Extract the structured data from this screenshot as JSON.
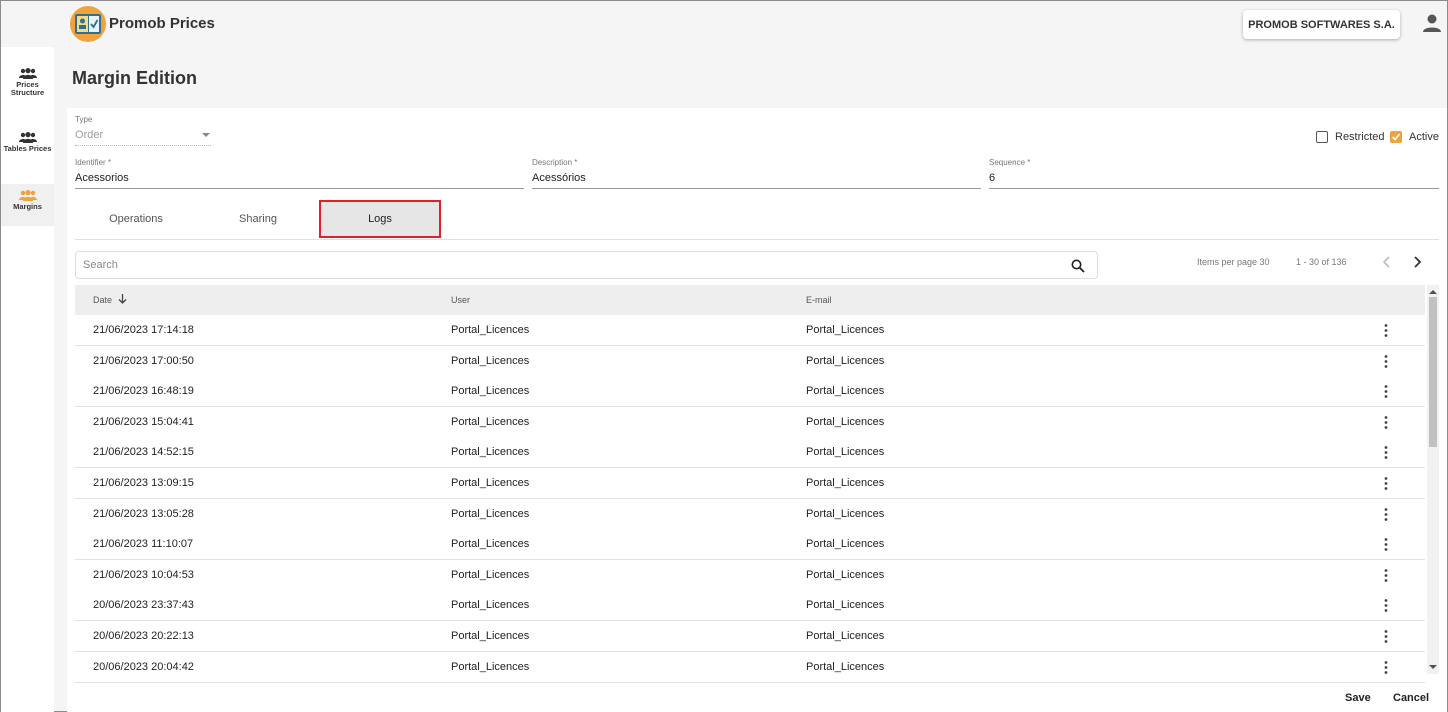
{
  "app": {
    "title": "Promob Prices",
    "company": "PROMOB SOFTWARES S.A.",
    "logo_icon": "price-tag-logo-icon",
    "accent_color": "#f0a23c"
  },
  "sidebar": {
    "items": [
      {
        "label": "Prices Structure",
        "icon": "people-icon",
        "active": false
      },
      {
        "label": "Tables Prices",
        "icon": "people-icon",
        "active": false
      },
      {
        "label": "Margins",
        "icon": "people-icon",
        "active": true
      }
    ]
  },
  "page": {
    "title": "Margin Edition"
  },
  "form": {
    "type": {
      "label": "Type",
      "value": "Order"
    },
    "identifier": {
      "label": "Identifier *",
      "value": "Acessorios"
    },
    "description": {
      "label": "Description *",
      "value": "Acessórios"
    },
    "sequence": {
      "label": "Sequence *",
      "value": "6"
    },
    "restricted": {
      "label": "Restricted",
      "checked": false
    },
    "active": {
      "label": "Active",
      "checked": true
    }
  },
  "tabs": [
    {
      "label": "Operations",
      "active": false
    },
    {
      "label": "Sharing",
      "active": false
    },
    {
      "label": "Logs",
      "active": true
    }
  ],
  "search": {
    "placeholder": "Search",
    "value": ""
  },
  "pagination": {
    "items_per_page_label": "Items per page 30",
    "range": "1 - 30 of 136"
  },
  "table": {
    "columns": [
      "Date",
      "User",
      "E-mail"
    ],
    "sort": {
      "column": "Date",
      "direction": "desc"
    },
    "rows": [
      {
        "date": "21/06/2023 17:14:18",
        "user": "Portal_Licences",
        "email": "Portal_Licences"
      },
      {
        "date": "21/06/2023 17:00:50",
        "user": "Portal_Licences",
        "email": "Portal_Licences"
      },
      {
        "date": "21/06/2023 16:48:19",
        "user": "Portal_Licences",
        "email": "Portal_Licences"
      },
      {
        "date": "21/06/2023 15:04:41",
        "user": "Portal_Licences",
        "email": "Portal_Licences"
      },
      {
        "date": "21/06/2023 14:52:15",
        "user": "Portal_Licences",
        "email": "Portal_Licences"
      },
      {
        "date": "21/06/2023 13:09:15",
        "user": "Portal_Licences",
        "email": "Portal_Licences"
      },
      {
        "date": "21/06/2023 13:05:28",
        "user": "Portal_Licences",
        "email": "Portal_Licences"
      },
      {
        "date": "21/06/2023 11:10:07",
        "user": "Portal_Licences",
        "email": "Portal_Licences"
      },
      {
        "date": "21/06/2023 10:04:53",
        "user": "Portal_Licences",
        "email": "Portal_Licences"
      },
      {
        "date": "20/06/2023 23:37:43",
        "user": "Portal_Licences",
        "email": "Portal_Licences"
      },
      {
        "date": "20/06/2023 20:22:13",
        "user": "Portal_Licences",
        "email": "Portal_Licences"
      },
      {
        "date": "20/06/2023 20:04:42",
        "user": "Portal_Licences",
        "email": "Portal_Licences"
      }
    ]
  },
  "footer": {
    "save_label": "Save",
    "cancel_label": "Cancel"
  }
}
